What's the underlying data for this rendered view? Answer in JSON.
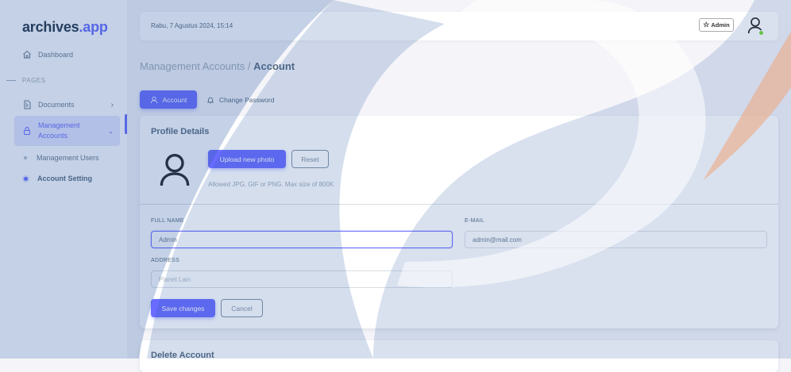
{
  "brand": {
    "name": "archives",
    "suffix": ".app"
  },
  "sidebar": {
    "dashboard": "Dashboard",
    "section": "PAGES",
    "documents": "Documents",
    "management_line1": "Management",
    "management_line2": "Accounts",
    "sub_items": [
      {
        "label": "Management Users"
      },
      {
        "label": "Account Setting"
      }
    ]
  },
  "navbar": {
    "date": "Rabu, 7 Agustus 2024, 15:14",
    "role_badge": "Admin"
  },
  "breadcrumb": {
    "parent": "Management Accounts /",
    "current": "Account"
  },
  "tabs": {
    "account": "Account",
    "change_password": "Change Password"
  },
  "profile": {
    "title": "Profile Details",
    "upload_label": "Upload new photo",
    "reset_label": "Reset",
    "hint": "Allowed JPG, GIF or PNG. Max size of 800K",
    "full_name_label": "FULL NAME",
    "full_name_value": "Admin",
    "email_label": "E-MAIL",
    "email_value": "admin@mail.com",
    "address_label": "ADDRESS",
    "address_placeholder": "Planet Lain",
    "save_label": "Save changes",
    "cancel_label": "Cancel"
  },
  "delete_account": {
    "title": "Delete Account"
  },
  "colors": {
    "accent": "#696cff",
    "online": "#71dd37",
    "watermark": "#2a5aa6"
  }
}
